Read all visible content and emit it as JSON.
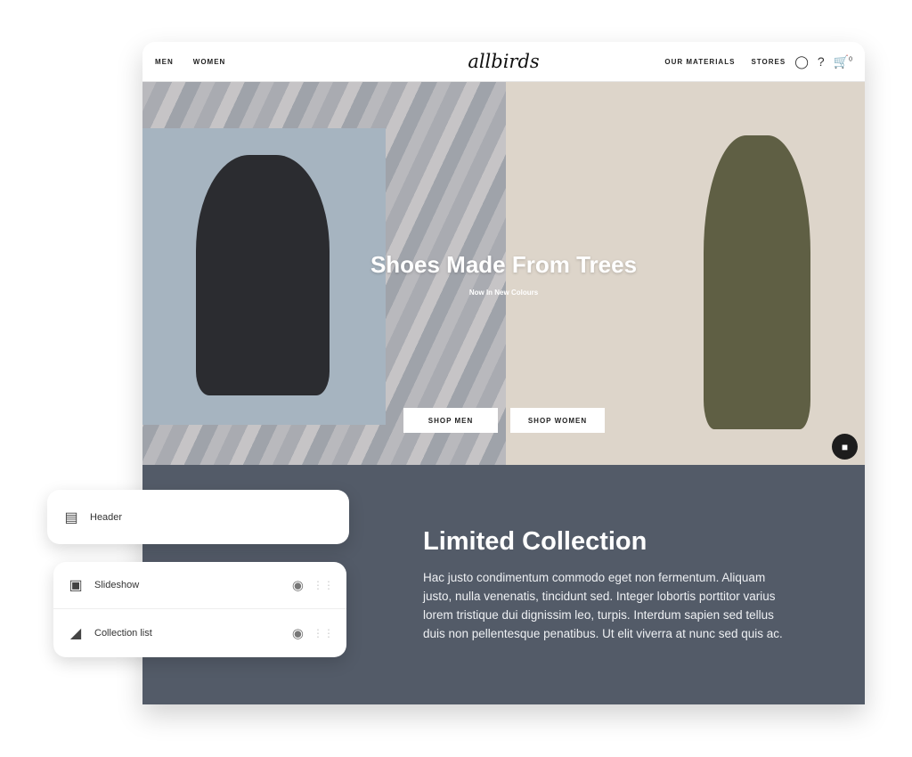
{
  "nav": {
    "left": [
      "MEN",
      "WOMEN"
    ],
    "logo": "allbirds",
    "right": [
      "OUR MATERIALS",
      "STORES"
    ],
    "cart_count": "0"
  },
  "hero": {
    "title": "Shoes Made From Trees",
    "subtitle": "Now In New Colours",
    "buttons": [
      "SHOP MEN",
      "SHOP WOMEN"
    ]
  },
  "collection": {
    "title": "Limited Collection",
    "body": "Hac justo condimentum commodo eget non fermentum. Aliquam justo, nulla venenatis, tincidunt sed. Integer lobortis porttitor varius lorem tristique dui dignissim leo, turpis. Interdum sapien sed tellus duis non pellentesque penatibus. Ut elit viverra at nunc sed quis ac."
  },
  "editor": {
    "header": "Header",
    "sections": [
      {
        "label": "Slideshow",
        "icon": "image-icon"
      },
      {
        "label": "Collection list",
        "icon": "tag-icon"
      }
    ]
  },
  "colors": {
    "section_bg": "#535b68"
  }
}
